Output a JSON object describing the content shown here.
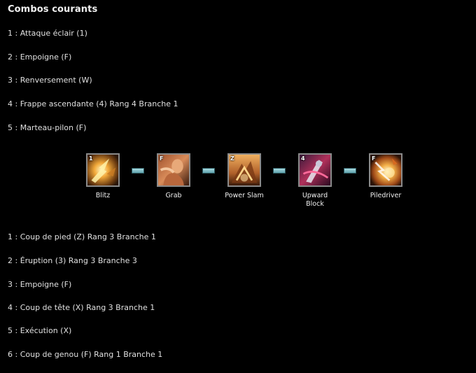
{
  "title": "Combos courants",
  "combo1": {
    "steps": [
      "1 : Attaque éclair (1)",
      "2 : Empoigne (F)",
      "3 : Renversement  (W)",
      "4 : Frappe ascendante (4) Rang 4 Branche 1",
      "5 : Marteau-pilon (F)"
    ]
  },
  "skills": [
    {
      "name": "Blitz",
      "key": "1",
      "icon": "blitz-icon"
    },
    {
      "name": "Grab",
      "key": "F",
      "icon": "grab-icon"
    },
    {
      "name": "Power Slam",
      "key": "Z",
      "icon": "power-slam-icon"
    },
    {
      "name": "Upward Block",
      "key": "4",
      "icon": "upward-block-icon"
    },
    {
      "name": "Piledriver",
      "key": "F",
      "icon": "piledriver-icon"
    }
  ],
  "combo2": {
    "steps": [
      "1 : Coup de pied (Z) Rang 3 Branche 1",
      "2 : Éruption (3) Rang 3 Branche 3",
      "3 : Empoigne (F)",
      "4 : Coup de tête (X) Rang 3 Branche 1",
      "5 : Exécution (X)",
      "6 : Coup de genou (F) Rang 1 Branche 1"
    ]
  },
  "colors": {
    "background": "#000000",
    "text": "#e0e0e0",
    "connector": "#7fc1ca",
    "icon_border": "#8a8a8a"
  }
}
